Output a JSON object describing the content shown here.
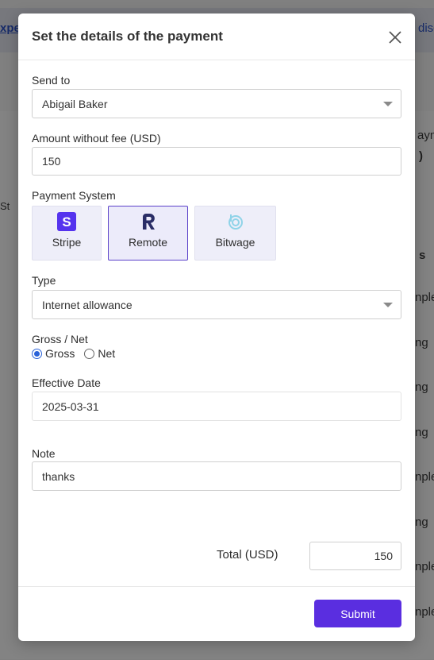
{
  "background": {
    "top_left_link": "xpe",
    "top_right_link": "disc",
    "right_partial_header": "aym",
    "right_partial_value": ")",
    "left_partial": "St",
    "column_header_partial": "s",
    "row_values": [
      "nple",
      "ng",
      "ng",
      "ng",
      "nple",
      "ng",
      "nple",
      "nple"
    ]
  },
  "modal": {
    "title": "Set the details of the payment",
    "send_to": {
      "label": "Send to",
      "value": "Abigail Baker"
    },
    "amount": {
      "label": "Amount without fee (USD)",
      "value": "150"
    },
    "payment_system": {
      "label": "Payment System",
      "options": [
        {
          "name": "Stripe",
          "icon": "stripe-icon"
        },
        {
          "name": "Remote",
          "icon": "remote-icon",
          "selected": true
        },
        {
          "name": "Bitwage",
          "icon": "bitwage-icon"
        }
      ]
    },
    "type": {
      "label": "Type",
      "value": "Internet allowance"
    },
    "gross_net": {
      "label": "Gross / Net",
      "options": [
        "Gross",
        "Net"
      ],
      "selected": "Gross"
    },
    "effective_date": {
      "label": "Effective Date",
      "value": "2025-03-31"
    },
    "note": {
      "label": "Note",
      "value": "thanks"
    },
    "total": {
      "label": "Total (USD)",
      "value": "150"
    },
    "submit_label": "Submit"
  },
  "colors": {
    "accent": "#5a2ee0",
    "selected_border": "#5b41c9",
    "card_bg": "#eeeef9",
    "radio": "#2a62d8"
  }
}
